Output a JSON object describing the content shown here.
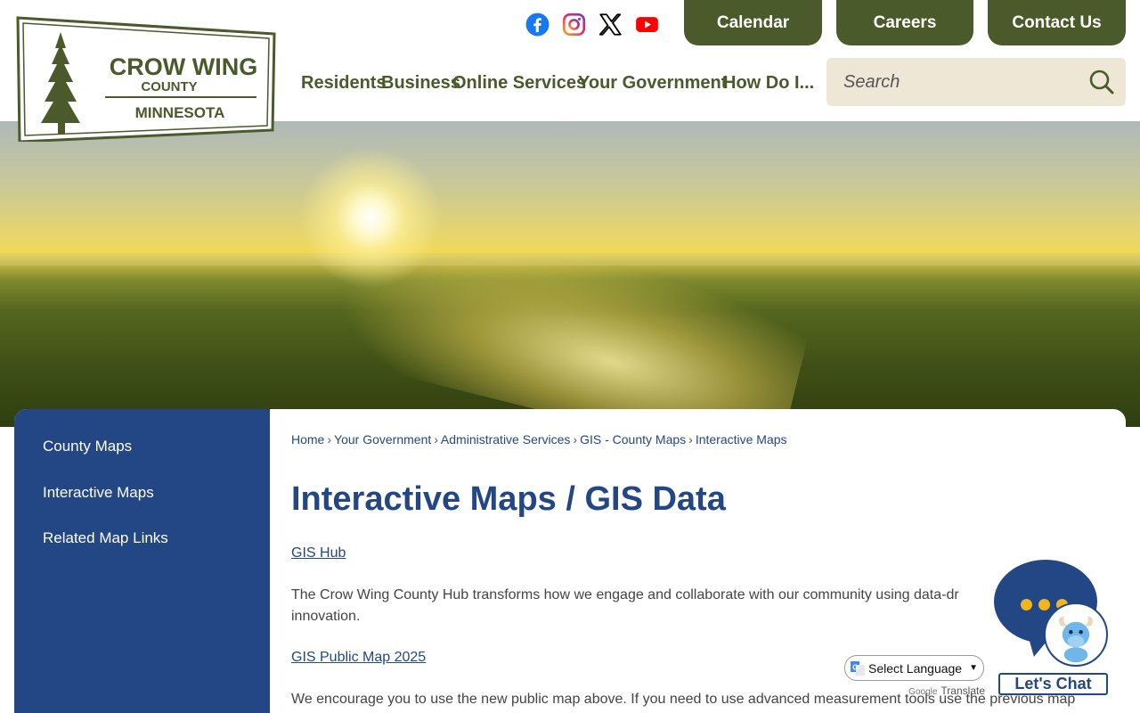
{
  "logo": {
    "line1": "CROW WING",
    "line2": "COUNTY",
    "line3": "MINNESOTA",
    "color": "#4a5a2a"
  },
  "social": [
    {
      "name": "facebook-icon",
      "color": "#1877f2"
    },
    {
      "name": "instagram-icon",
      "color": "#c13584"
    },
    {
      "name": "x-icon",
      "color": "#000000"
    },
    {
      "name": "youtube-icon",
      "color": "#ff0000"
    }
  ],
  "top_buttons": [
    "Calendar",
    "Careers",
    "Contact Us"
  ],
  "nav": [
    "Residents",
    "Business",
    "Online Services",
    "Your Government",
    "How Do I..."
  ],
  "search": {
    "placeholder": "Search"
  },
  "sidebar": {
    "items": [
      "County Maps",
      "Interactive Maps",
      "Related Map Links"
    ]
  },
  "breadcrumb": [
    "Home",
    "Your Government",
    "Administrative Services",
    "GIS - County Maps",
    "Interactive Maps"
  ],
  "page": {
    "title": "Interactive Maps / GIS Data",
    "link1": "GIS Hub",
    "para1_line1": "The Crow Wing County Hub transforms how we engage and collaborate with our community using data-dr",
    "para1_line2": "innovation.",
    "link2": "GIS Public Map 2025",
    "para2": "We encourage you to use the new public map above.  If you need to use advanced measurement tools use the previous map"
  },
  "translate": {
    "select_label": "Select Language",
    "powered_by": "Google",
    "powered_text": "Translate"
  },
  "chat": {
    "label": "Let's Chat"
  },
  "colors": {
    "olive": "#4a5a2a",
    "navy": "#234785",
    "search_bg": "#efe7d6",
    "chat_dots": "#f2b51c"
  }
}
